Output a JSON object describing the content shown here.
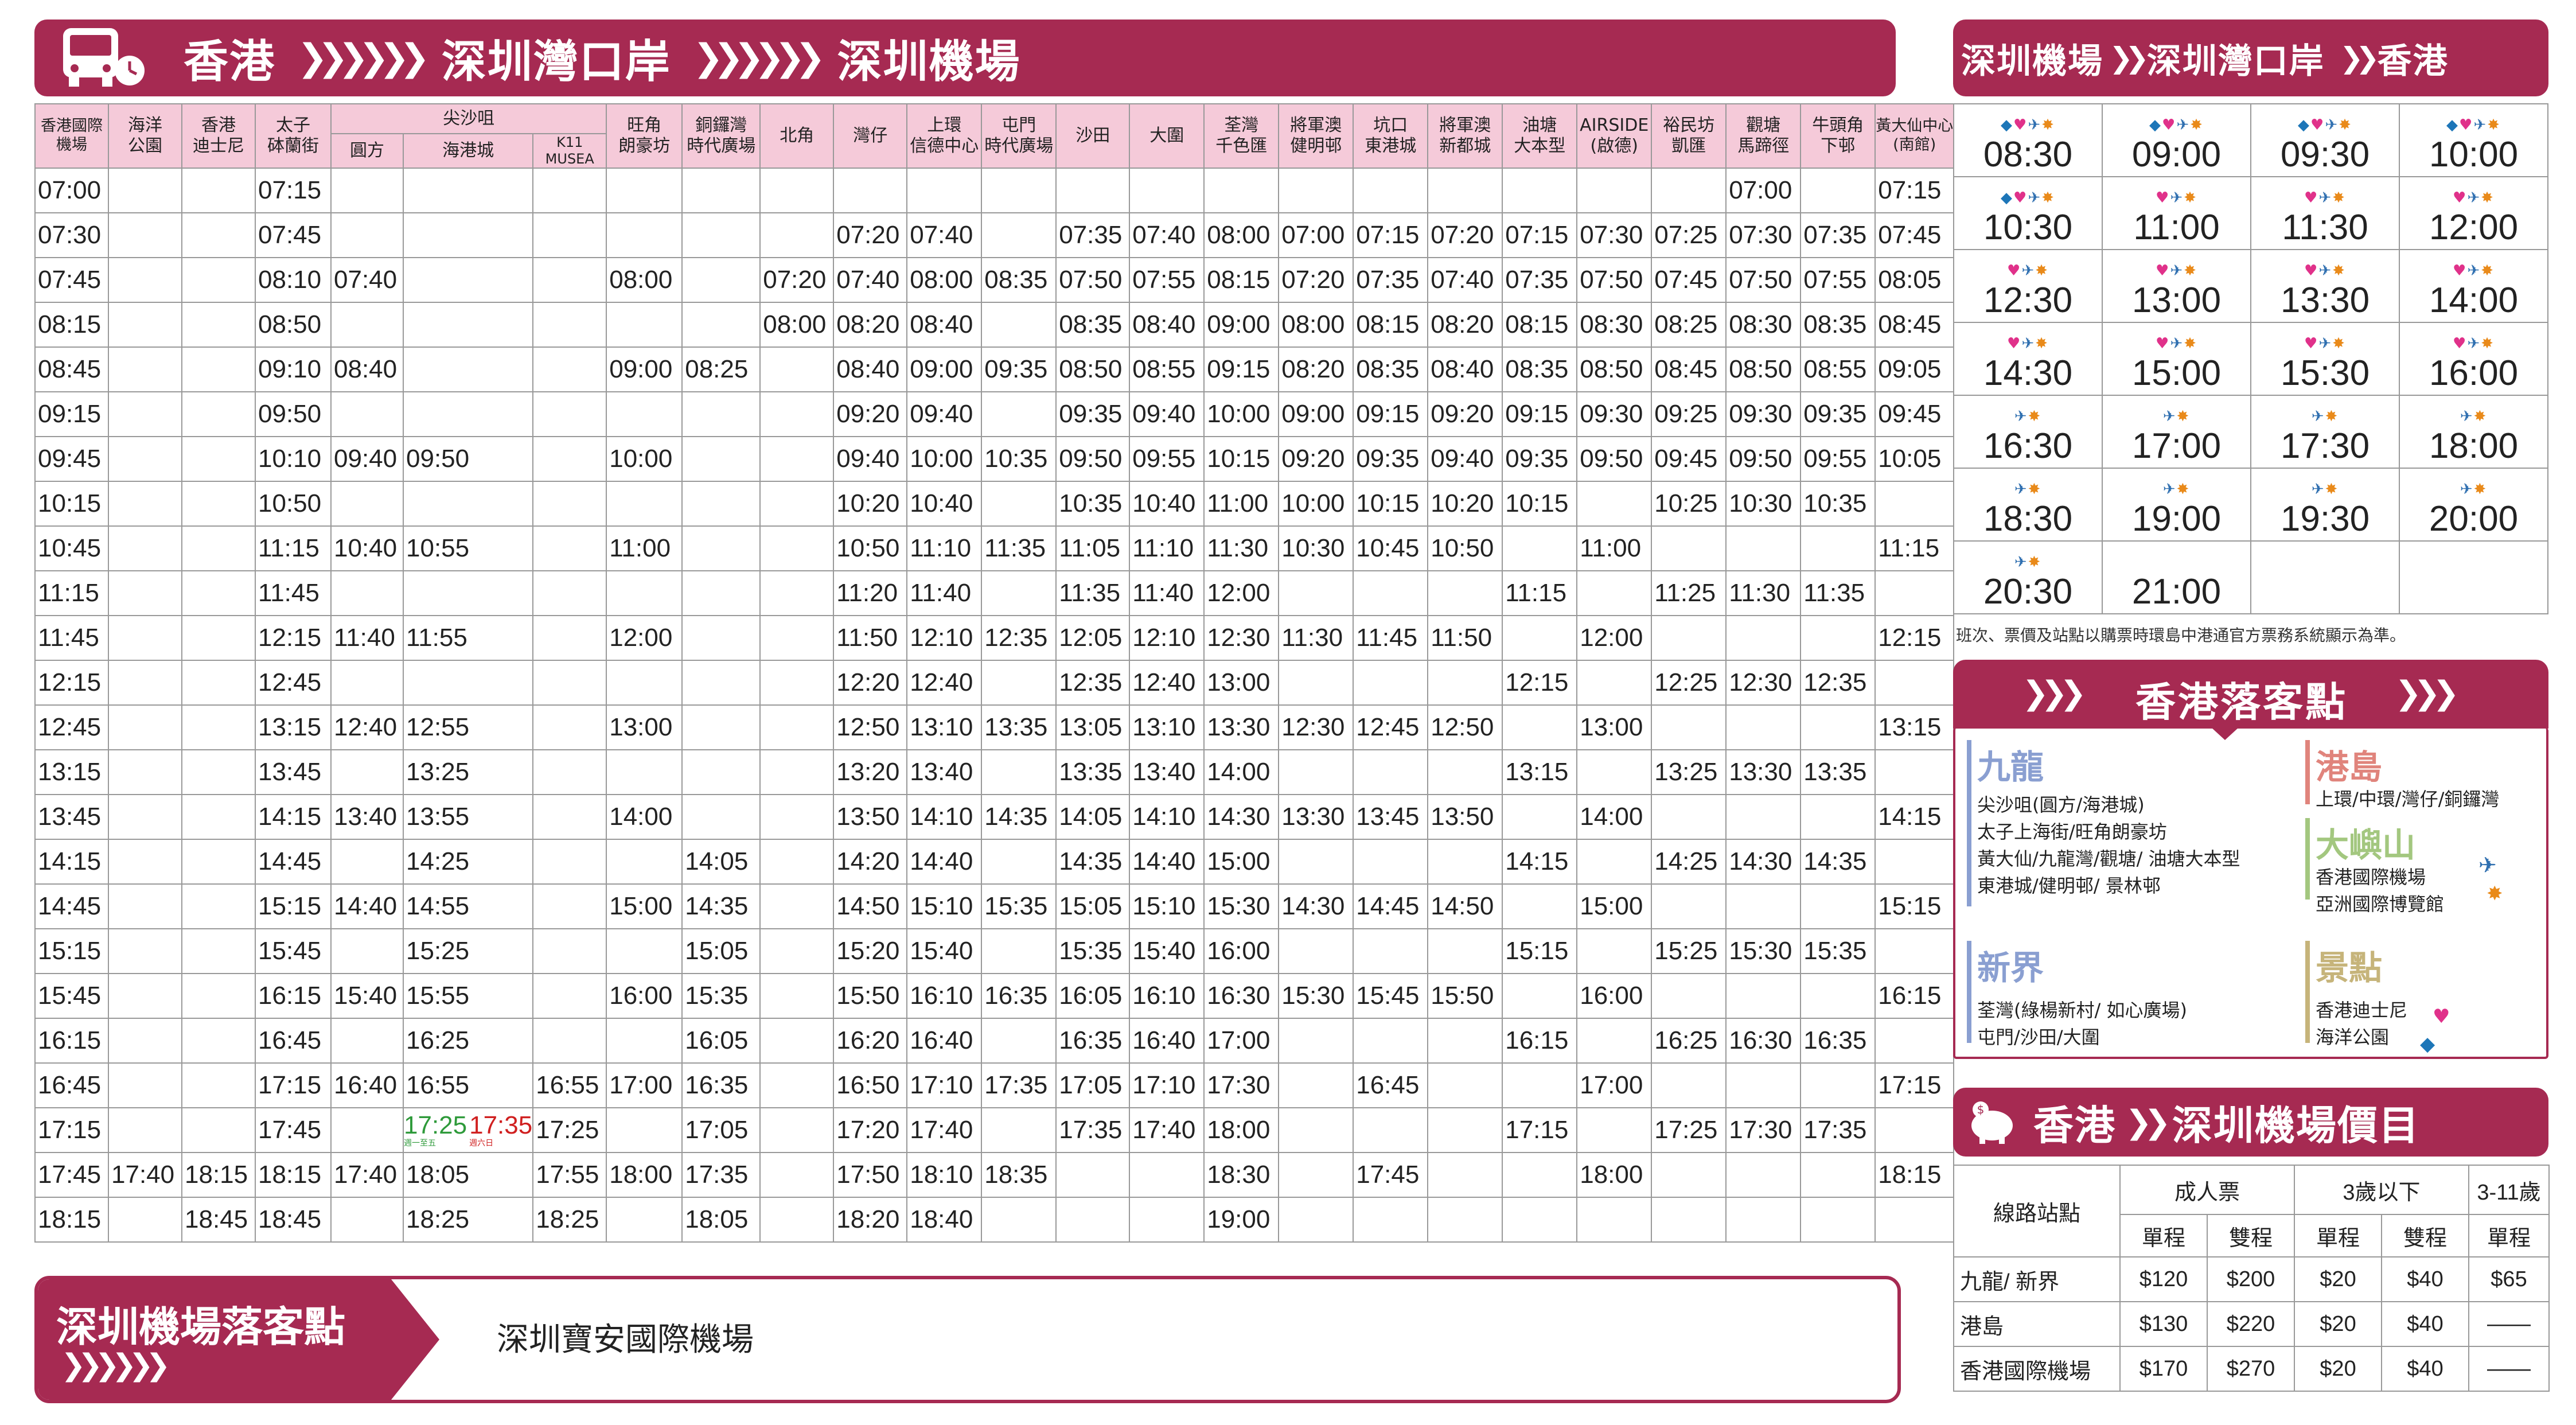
{
  "top_bar": {
    "a": "香港",
    "b": "深圳灣口岸",
    "c": "深圳機場",
    "arrows": "❯❯❯❯❯❯"
  },
  "columns": [
    {
      "l1": "香港國際",
      "l2": "機場"
    },
    {
      "l1": "海洋",
      "l2": "公園"
    },
    {
      "l1": "香港",
      "l2": "迪士尼"
    },
    {
      "l1": "太子",
      "l2": "砵蘭街"
    },
    {
      "l1": "",
      "l2": "圓方"
    },
    {
      "l1": "",
      "l2": "海港城"
    },
    {
      "l1": "K11",
      "l2": "MUSEA"
    },
    {
      "l1": "旺角",
      "l2": "朗豪坊"
    },
    {
      "l1": "銅鑼灣",
      "l2": "時代廣場"
    },
    {
      "l1": "北角",
      "l2": ""
    },
    {
      "l1": "灣仔",
      "l2": ""
    },
    {
      "l1": "上環",
      "l2": "信德中心"
    },
    {
      "l1": "屯門",
      "l2": "時代廣場"
    },
    {
      "l1": "沙田",
      "l2": ""
    },
    {
      "l1": "大圍",
      "l2": ""
    },
    {
      "l1": "荃灣",
      "l2": "千色匯"
    },
    {
      "l1": "將軍澳",
      "l2": "健明邨"
    },
    {
      "l1": "坑口",
      "l2": "東港城"
    },
    {
      "l1": "將軍澳",
      "l2": "新都城"
    },
    {
      "l1": "油塘",
      "l2": "大本型"
    },
    {
      "l1": "AIRSIDE",
      "l2": "(啟德)"
    },
    {
      "l1": "裕民坊",
      "l2": "凱匯"
    },
    {
      "l1": "觀塘",
      "l2": "馬蹄徑"
    },
    {
      "l1": "牛頭角",
      "l2": "下邨"
    },
    {
      "l1": "黃大仙中心",
      "l2": "(南館)"
    }
  ],
  "tst_group": "尖沙咀",
  "rows": [
    [
      "07:00",
      "",
      "",
      "07:15",
      "",
      "",
      "",
      "",
      "",
      "",
      "",
      "",
      "",
      "",
      "",
      "",
      "",
      "",
      "",
      "",
      "",
      "",
      "07:00",
      "",
      "07:15"
    ],
    [
      "07:30",
      "",
      "",
      "07:45",
      "",
      "",
      "",
      "",
      "",
      "",
      "07:20",
      "07:40",
      "",
      "07:35",
      "07:40",
      "08:00",
      "07:00",
      "07:15",
      "07:20",
      "07:15",
      "07:30",
      "07:25",
      "07:30",
      "07:35",
      "07:45"
    ],
    [
      "07:45",
      "",
      "",
      "08:10",
      "07:40",
      "",
      "",
      "08:00",
      "",
      "07:20",
      "07:40",
      "08:00",
      "08:35",
      "07:50",
      "07:55",
      "08:15",
      "07:20",
      "07:35",
      "07:40",
      "07:35",
      "07:50",
      "07:45",
      "07:50",
      "07:55",
      "08:05"
    ],
    [
      "08:15",
      "",
      "",
      "08:50",
      "",
      "",
      "",
      "",
      "",
      "08:00",
      "08:20",
      "08:40",
      "",
      "08:35",
      "08:40",
      "09:00",
      "08:00",
      "08:15",
      "08:20",
      "08:15",
      "08:30",
      "08:25",
      "08:30",
      "08:35",
      "08:45"
    ],
    [
      "08:45",
      "",
      "",
      "09:10",
      "08:40",
      "",
      "",
      "09:00",
      "08:25",
      "",
      "08:40",
      "09:00",
      "09:35",
      "08:50",
      "08:55",
      "09:15",
      "08:20",
      "08:35",
      "08:40",
      "08:35",
      "08:50",
      "08:45",
      "08:50",
      "08:55",
      "09:05"
    ],
    [
      "09:15",
      "",
      "",
      "09:50",
      "",
      "",
      "",
      "",
      "",
      "",
      "09:20",
      "09:40",
      "",
      "09:35",
      "09:40",
      "10:00",
      "09:00",
      "09:15",
      "09:20",
      "09:15",
      "09:30",
      "09:25",
      "09:30",
      "09:35",
      "09:45"
    ],
    [
      "09:45",
      "",
      "",
      "10:10",
      "09:40",
      "09:50",
      "",
      "10:00",
      "",
      "",
      "09:40",
      "10:00",
      "10:35",
      "09:50",
      "09:55",
      "10:15",
      "09:20",
      "09:35",
      "09:40",
      "09:35",
      "09:50",
      "09:45",
      "09:50",
      "09:55",
      "10:05"
    ],
    [
      "10:15",
      "",
      "",
      "10:50",
      "",
      "",
      "",
      "",
      "",
      "",
      "10:20",
      "10:40",
      "",
      "10:35",
      "10:40",
      "11:00",
      "10:00",
      "10:15",
      "10:20",
      "10:15",
      "",
      "10:25",
      "10:30",
      "10:35",
      ""
    ],
    [
      "10:45",
      "",
      "",
      "11:15",
      "10:40",
      "10:55",
      "",
      "11:00",
      "",
      "",
      "10:50",
      "11:10",
      "11:35",
      "11:05",
      "11:10",
      "11:30",
      "10:30",
      "10:45",
      "10:50",
      "",
      "11:00",
      "",
      "",
      "",
      "11:15"
    ],
    [
      "11:15",
      "",
      "",
      "11:45",
      "",
      "",
      "",
      "",
      "",
      "",
      "11:20",
      "11:40",
      "",
      "11:35",
      "11:40",
      "12:00",
      "",
      "",
      "",
      "11:15",
      "",
      "11:25",
      "11:30",
      "11:35",
      ""
    ],
    [
      "11:45",
      "",
      "",
      "12:15",
      "11:40",
      "11:55",
      "",
      "12:00",
      "",
      "",
      "11:50",
      "12:10",
      "12:35",
      "12:05",
      "12:10",
      "12:30",
      "11:30",
      "11:45",
      "11:50",
      "",
      "12:00",
      "",
      "",
      "",
      "12:15"
    ],
    [
      "12:15",
      "",
      "",
      "12:45",
      "",
      "",
      "",
      "",
      "",
      "",
      "12:20",
      "12:40",
      "",
      "12:35",
      "12:40",
      "13:00",
      "",
      "",
      "",
      "12:15",
      "",
      "12:25",
      "12:30",
      "12:35",
      ""
    ],
    [
      "12:45",
      "",
      "",
      "13:15",
      "12:40",
      "12:55",
      "",
      "13:00",
      "",
      "",
      "12:50",
      "13:10",
      "13:35",
      "13:05",
      "13:10",
      "13:30",
      "12:30",
      "12:45",
      "12:50",
      "",
      "13:00",
      "",
      "",
      "",
      "13:15"
    ],
    [
      "13:15",
      "",
      "",
      "13:45",
      "",
      "13:25",
      "",
      "",
      "",
      "",
      "13:20",
      "13:40",
      "",
      "13:35",
      "13:40",
      "14:00",
      "",
      "",
      "",
      "13:15",
      "",
      "13:25",
      "13:30",
      "13:35",
      ""
    ],
    [
      "13:45",
      "",
      "",
      "14:15",
      "13:40",
      "13:55",
      "",
      "14:00",
      "",
      "",
      "13:50",
      "14:10",
      "14:35",
      "14:05",
      "14:10",
      "14:30",
      "13:30",
      "13:45",
      "13:50",
      "",
      "14:00",
      "",
      "",
      "",
      "14:15"
    ],
    [
      "14:15",
      "",
      "",
      "14:45",
      "",
      "14:25",
      "",
      "",
      "14:05",
      "",
      "14:20",
      "14:40",
      "",
      "14:35",
      "14:40",
      "15:00",
      "",
      "",
      "",
      "14:15",
      "",
      "14:25",
      "14:30",
      "14:35",
      ""
    ],
    [
      "14:45",
      "",
      "",
      "15:15",
      "14:40",
      "14:55",
      "",
      "15:00",
      "14:35",
      "",
      "14:50",
      "15:10",
      "15:35",
      "15:05",
      "15:10",
      "15:30",
      "14:30",
      "14:45",
      "14:50",
      "",
      "15:00",
      "",
      "",
      "",
      "15:15"
    ],
    [
      "15:15",
      "",
      "",
      "15:45",
      "",
      "15:25",
      "",
      "",
      "15:05",
      "",
      "15:20",
      "15:40",
      "",
      "15:35",
      "15:40",
      "16:00",
      "",
      "",
      "",
      "15:15",
      "",
      "15:25",
      "15:30",
      "15:35",
      ""
    ],
    [
      "15:45",
      "",
      "",
      "16:15",
      "15:40",
      "15:55",
      "",
      "16:00",
      "15:35",
      "",
      "15:50",
      "16:10",
      "16:35",
      "16:05",
      "16:10",
      "16:30",
      "15:30",
      "15:45",
      "15:50",
      "",
      "16:00",
      "",
      "",
      "",
      "16:15"
    ],
    [
      "16:15",
      "",
      "",
      "16:45",
      "",
      "16:25",
      "",
      "",
      "16:05",
      "",
      "16:20",
      "16:40",
      "",
      "16:35",
      "16:40",
      "17:00",
      "",
      "",
      "",
      "16:15",
      "",
      "16:25",
      "16:30",
      "16:35",
      ""
    ],
    [
      "16:45",
      "",
      "",
      "17:15",
      "16:40",
      "16:55",
      "16:55",
      "17:00",
      "16:35",
      "",
      "16:50",
      "17:10",
      "17:35",
      "17:05",
      "17:10",
      "17:30",
      "",
      "16:45",
      "",
      "",
      "17:00",
      "",
      "",
      "",
      "17:15"
    ],
    [
      "17:15",
      "",
      "",
      "17:45",
      "",
      "",
      "17:25",
      "",
      "17:05",
      "",
      "17:20",
      "17:40",
      "",
      "17:35",
      "17:40",
      "18:00",
      "",
      "",
      "",
      "17:15",
      "",
      "17:25",
      "17:30",
      "17:35",
      ""
    ],
    [
      "17:45",
      "17:40",
      "18:15",
      "18:15",
      "17:40",
      "18:05",
      "17:55",
      "18:00",
      "17:35",
      "",
      "17:50",
      "18:10",
      "18:35",
      "",
      "",
      "18:30",
      "",
      "17:45",
      "",
      "",
      "18:00",
      "",
      "",
      "",
      "18:15"
    ],
    [
      "18:15",
      "",
      "18:45",
      "18:45",
      "",
      "18:25",
      "18:25",
      "",
      "18:05",
      "",
      "18:20",
      "18:40",
      "",
      "",
      "",
      "19:00",
      "",
      "",
      "",
      "",
      "",
      "",
      "",
      "",
      ""
    ]
  ],
  "special_cell": {
    "green": "17:25",
    "red": "17:35",
    "green_note": "週一至五",
    "red_note": "週六日"
  },
  "right_bar": {
    "a": "深圳機場",
    "b": "深圳灣口岸",
    "c": "香港",
    "arrows": "❯❯"
  },
  "schedule": [
    {
      "t": "08:30",
      "icons": "dmps"
    },
    {
      "t": "09:00",
      "icons": "dmps"
    },
    {
      "t": "09:30",
      "icons": "dmps"
    },
    {
      "t": "10:00",
      "icons": "dmps"
    },
    {
      "t": "10:30",
      "icons": "dmps"
    },
    {
      "t": "11:00",
      "icons": "mps"
    },
    {
      "t": "11:30",
      "icons": "mps"
    },
    {
      "t": "12:00",
      "icons": "mps"
    },
    {
      "t": "12:30",
      "icons": "mps"
    },
    {
      "t": "13:00",
      "icons": "mps"
    },
    {
      "t": "13:30",
      "icons": "mps"
    },
    {
      "t": "14:00",
      "icons": "mps"
    },
    {
      "t": "14:30",
      "icons": "mps"
    },
    {
      "t": "15:00",
      "icons": "mps"
    },
    {
      "t": "15:30",
      "icons": "mps"
    },
    {
      "t": "16:00",
      "icons": "mps"
    },
    {
      "t": "16:30",
      "icons": "ps"
    },
    {
      "t": "17:00",
      "icons": "ps"
    },
    {
      "t": "17:30",
      "icons": "ps"
    },
    {
      "t": "18:00",
      "icons": "ps"
    },
    {
      "t": "18:30",
      "icons": "ps"
    },
    {
      "t": "19:00",
      "icons": "ps"
    },
    {
      "t": "19:30",
      "icons": "ps"
    },
    {
      "t": "20:00",
      "icons": "ps"
    },
    {
      "t": "20:30",
      "icons": "ps"
    },
    {
      "t": "21:00",
      "icons": ""
    },
    {
      "t": "",
      "icons": ""
    },
    {
      "t": "",
      "icons": ""
    }
  ],
  "note": "班次、票價及站點以購票時環島中港通官方票務系統顯示為準。",
  "drop_title": "香港落客點",
  "drop_arrows": "❯❯❯",
  "regions": {
    "kowloon": {
      "name": "九龍",
      "lines": [
        "尖沙咀(圓方/海港城)",
        "太子上海街/旺角朗豪坊",
        "黃大仙/九龍灣/觀塘/ 油塘大本型",
        "東港城/健明邨/ 景林邨"
      ],
      "color": "#8a9fd1"
    },
    "island": {
      "name": "港島",
      "lines": [
        "上環/中環/灣仔/銅鑼灣"
      ],
      "color": "#e0847c"
    },
    "lantau": {
      "name": "大嶼山",
      "lines": [
        "香港國際機場",
        "亞洲國際博覽館"
      ],
      "color": "#a3c77f"
    },
    "nt": {
      "name": "新界",
      "lines": [
        "荃灣(綠楊新村/ 如心廣場)",
        "屯門/沙田/大圍"
      ],
      "color": "#8a9fd1"
    },
    "spots": {
      "name": "景點",
      "lines": [
        "香港迪士尼",
        "海洋公園"
      ],
      "color": "#c6b47a"
    }
  },
  "price_title": {
    "a": "香港",
    "b": "深圳機場價目",
    "arrows": "❯❯"
  },
  "price": {
    "h_route": "線路站點",
    "h_adult": "成人票",
    "h_under3": "3歲以下",
    "h_child": "3-11歲",
    "single": "單程",
    "return": "雙程",
    "rows": [
      [
        "九龍/ 新界",
        "$120",
        "$200",
        "$20",
        "$40",
        "$65"
      ],
      [
        "港島",
        "$130",
        "$220",
        "$20",
        "$40",
        "——"
      ],
      [
        "香港國際機場",
        "$170",
        "$270",
        "$20",
        "$40",
        "——"
      ]
    ]
  },
  "bottom": {
    "title": "深圳機場落客點",
    "arrows": "❯❯❯❯❯❯",
    "text": "深圳寶安國際機場"
  },
  "colors": {
    "accent": "#a62a52",
    "header_pink": "#f5cad9"
  }
}
